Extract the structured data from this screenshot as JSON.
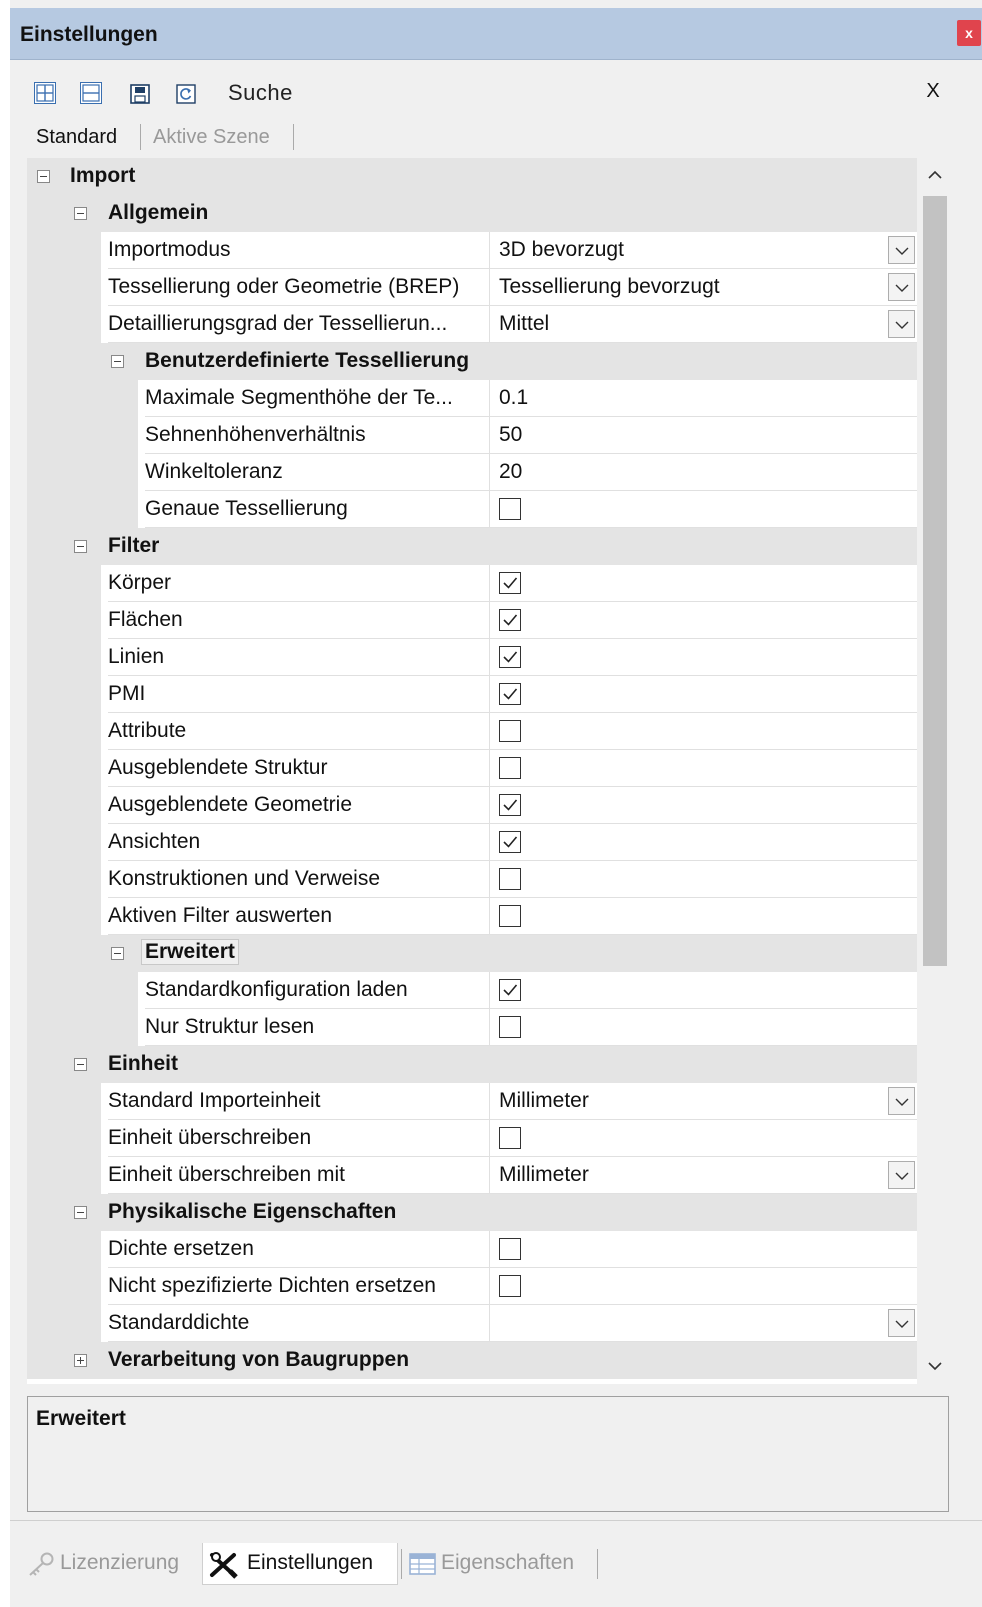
{
  "window": {
    "title": "Einstellungen",
    "close_glyph": "x"
  },
  "toolbar": {
    "buttons": [
      {
        "icon": "expand-all-icon"
      },
      {
        "icon": "collapse-all-icon"
      },
      {
        "icon": "save-icon"
      },
      {
        "icon": "reset-icon"
      }
    ],
    "search_label": "Suche",
    "clear_label": "X"
  },
  "tabs": {
    "standard": "Standard",
    "active_scene": "Aktive Szene"
  },
  "grid": {
    "import": "Import",
    "allgemein": {
      "title": "Allgemein",
      "importmodus": {
        "name": "Importmodus",
        "value": "3D bevorzugt"
      },
      "tessellierung": {
        "name": "Tessellierung oder Geometrie (BREP)",
        "value": "Tessellierung bevorzugt"
      },
      "detail": {
        "name": "Detaillierungsgrad der Tessellierun...",
        "value": "Mittel"
      }
    },
    "benutzer": {
      "title": "Benutzerdefinierte Tessellierung",
      "segment": {
        "name": "Maximale Segmenthöhe der Te...",
        "value": "0.1"
      },
      "sehnen": {
        "name": "Sehnenhöhenverhältnis",
        "value": "50"
      },
      "winkel": {
        "name": "Winkeltoleranz",
        "value": "20"
      },
      "genau": {
        "name": "Genaue Tessellierung",
        "checked": false
      }
    },
    "filter": {
      "title": "Filter",
      "items": [
        {
          "name": "Körper",
          "checked": true
        },
        {
          "name": "Flächen",
          "checked": true
        },
        {
          "name": "Linien",
          "checked": true
        },
        {
          "name": "PMI",
          "checked": true
        },
        {
          "name": "Attribute",
          "checked": false
        },
        {
          "name": "Ausgeblendete Struktur",
          "checked": false
        },
        {
          "name": "Ausgeblendete Geometrie",
          "checked": true
        },
        {
          "name": "Ansichten",
          "checked": true
        },
        {
          "name": "Konstruktionen und Verweise",
          "checked": false
        },
        {
          "name": "Aktiven Filter auswerten",
          "checked": false
        }
      ]
    },
    "erweitert": {
      "title": "Erweitert",
      "items": [
        {
          "name": "Standardkonfiguration laden",
          "checked": true
        },
        {
          "name": "Nur Struktur lesen",
          "checked": false
        }
      ]
    },
    "einheit": {
      "title": "Einheit",
      "standard": {
        "name": "Standard Importeinheit",
        "value": "Millimeter"
      },
      "ueberschreiben": {
        "name": "Einheit überschreiben",
        "checked": false
      },
      "mit": {
        "name": "Einheit überschreiben mit",
        "value": "Millimeter"
      }
    },
    "physik": {
      "title": "Physikalische Eigenschaften",
      "dichte": {
        "name": "Dichte ersetzen",
        "checked": false
      },
      "nicht": {
        "name": "Nicht spezifizierte Dichten ersetzen",
        "checked": false
      },
      "standarddichte": {
        "name": "Standarddichte",
        "value": ""
      }
    },
    "baugruppen": "Verarbeitung von Baugruppen"
  },
  "description": {
    "title": "Erweitert"
  },
  "bottom_tabs": [
    {
      "label": "Lizenzierung",
      "icon": "key-icon",
      "active": false
    },
    {
      "label": "Einstellungen",
      "icon": "tools-icon",
      "active": true
    },
    {
      "label": "Eigenschaften",
      "icon": "table-icon",
      "active": false
    }
  ],
  "colors": {
    "titlebar": "#b6c9e1",
    "category_row": "#e4e4e4",
    "close_button": "#e0444d",
    "accent_blue": "#3a6fb0"
  }
}
